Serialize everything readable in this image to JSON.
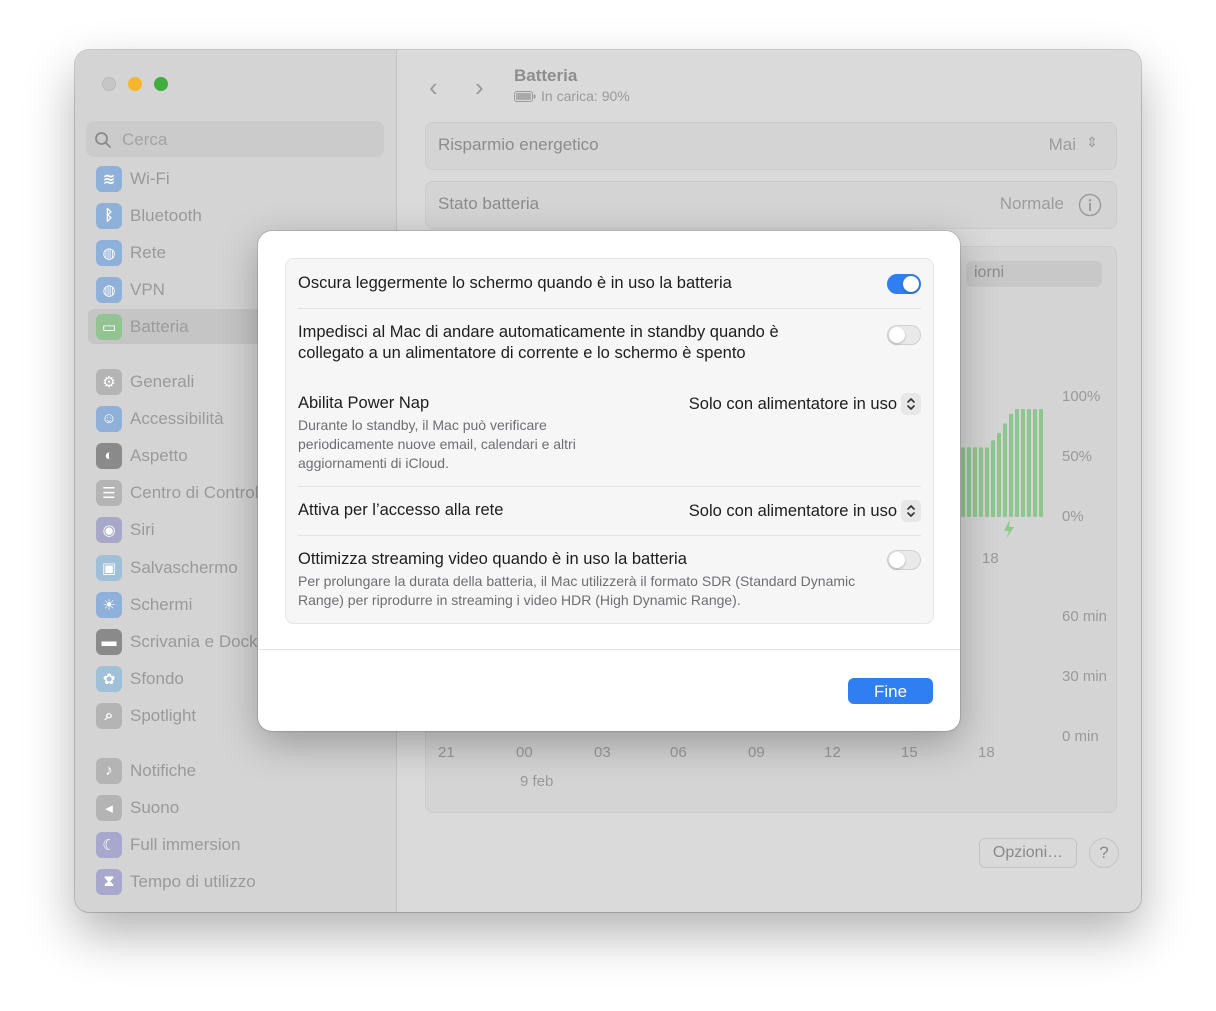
{
  "sidebar": {
    "search_placeholder": "Cerca",
    "items": [
      {
        "label": "Wi-Fi",
        "icon": "wifi-icon",
        "color": "#8fb0d9"
      },
      {
        "label": "Bluetooth",
        "icon": "bluetooth-icon",
        "color": "#8fb0d9"
      },
      {
        "label": "Rete",
        "icon": "globe-icon",
        "color": "#8fb0d9"
      },
      {
        "label": "VPN",
        "icon": "vpn-globe-icon",
        "color": "#8fb0d9"
      },
      {
        "label": "Batteria",
        "icon": "battery-icon",
        "color": "#93c293"
      },
      {
        "label": "Generali",
        "icon": "gear-icon",
        "color": "#b4b4b4"
      },
      {
        "label": "Accessibilità",
        "icon": "accessibility-icon",
        "color": "#8fb0d9"
      },
      {
        "label": "Aspetto",
        "icon": "appearance-icon",
        "color": "#8a8a8a"
      },
      {
        "label": "Centro di Controllo",
        "icon": "control-center-icon",
        "color": "#b4b4b4"
      },
      {
        "label": "Siri",
        "icon": "siri-icon",
        "color": "#a7a7c7"
      },
      {
        "label": "Salvaschermo",
        "icon": "screensaver-icon",
        "color": "#9fc0d7"
      },
      {
        "label": "Schermi",
        "icon": "display-icon",
        "color": "#8fb0d9"
      },
      {
        "label": "Scrivania e Dock",
        "icon": "dock-icon",
        "color": "#8a8a8a"
      },
      {
        "label": "Sfondo",
        "icon": "wallpaper-icon",
        "color": "#9fc0d7"
      },
      {
        "label": "Spotlight",
        "icon": "spotlight-icon",
        "color": "#b4b4b4"
      },
      {
        "label": "Notifiche",
        "icon": "bell-icon",
        "color": "#b4b4b4"
      },
      {
        "label": "Suono",
        "icon": "speaker-icon",
        "color": "#b4b4b4"
      },
      {
        "label": "Full immersion",
        "icon": "moon-icon",
        "color": "#a8a8cc"
      },
      {
        "label": "Tempo di utilizzo",
        "icon": "hourglass-icon",
        "color": "#a8a8cc"
      }
    ]
  },
  "header": {
    "title": "Batteria",
    "subtitle": "In carica: 90%"
  },
  "main": {
    "energy_label": "Risparmio energetico",
    "energy_value": "Mai",
    "battery_state_label": "Stato batteria",
    "battery_state_value": "Normale",
    "segment_label": "iorni",
    "level_axis": [
      "100%",
      "50%",
      "0%"
    ],
    "usage_axis": [
      "60 min",
      "30 min",
      "0 min"
    ],
    "hour_ticks": [
      "21",
      "00",
      "03",
      "06",
      "09",
      "12",
      "15",
      "18"
    ],
    "level_tick": "18",
    "date_label": "9 feb",
    "options_label": "Opzioni…",
    "help_label": "?"
  },
  "modal": {
    "dim_label": "Oscura leggermente lo schermo quando è in uso la batteria",
    "dim_on": true,
    "standby_label": "Impedisci al Mac di andare automaticamente in standby quando è collegato a un alimentatore di corrente e lo schermo è spento",
    "standby_on": false,
    "powernap_label": "Abilita Power Nap",
    "powernap_desc": "Durante lo standby, il Mac può verificare periodicamente nuove email, calendari e altri aggiornamenti di iCloud.",
    "powernap_value": "Solo con alimentatore in uso",
    "network_label": "Attiva per l’accesso alla rete",
    "network_value": "Solo con alimentatore in uso",
    "streaming_label": "Ottimizza streaming video quando è in uso la batteria",
    "streaming_desc": "Per prolungare la durata della batteria, il Mac utilizzerà il formato SDR (Standard Dynamic Range) per riprodurre in streaming i video HDR (High Dynamic Range).",
    "streaming_on": false,
    "done_label": "Fine"
  },
  "chart_data": {
    "type": "bar",
    "series": [
      {
        "values": [
          0.58,
          0.58,
          0.58,
          0.58,
          0.58,
          0.64,
          0.7,
          0.78,
          0.86,
          0.9,
          0.9,
          0.9,
          0.9,
          0.9
        ]
      }
    ],
    "ylim": [
      0,
      100
    ]
  },
  "colors": {
    "accent": "#2f7ff2",
    "battery_green": "#8ec78e"
  }
}
